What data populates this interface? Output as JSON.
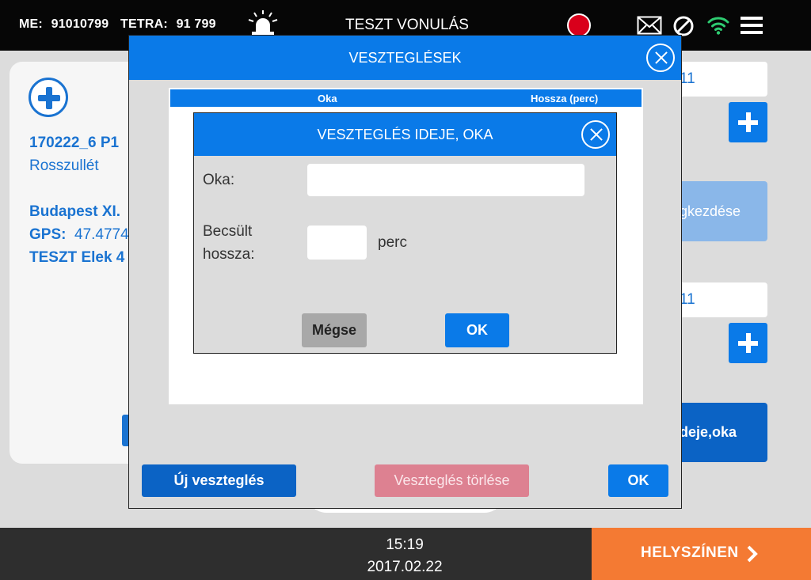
{
  "topbar": {
    "me_label": "ME:",
    "me_value": "91010799",
    "tetra_label": "TETRA:",
    "tetra_value": "91 799",
    "title": "TESZT VONULÁS",
    "icons": [
      "siren-icon",
      "record-indicator",
      "mail-icon",
      "block-icon",
      "wifi-icon",
      "menu-icon"
    ],
    "colors": {
      "record": "#d9001b",
      "wifi": "#2ecc71"
    }
  },
  "case": {
    "id_line": "170222_6  P1",
    "type": "Rosszullét",
    "address": "Budapest XI.",
    "gps_label": "GPS:",
    "gps_value": "47.4774",
    "person": "TESZT Elek  4"
  },
  "right_panel": {
    "field1": "11",
    "field2": "11",
    "faded_button": "gkezdése",
    "dark_button": "deje,oka"
  },
  "bottombar": {
    "time": "15:19",
    "date": "2017.02.22",
    "action": "HELYSZÍNEN"
  },
  "modal_outer": {
    "title": "VESZTEGLÉSEK",
    "columns": [
      "Oka",
      "Hossza (perc)"
    ],
    "new_button": "Új veszteglés",
    "delete_button": "Veszteglés törlése",
    "ok_button": "OK"
  },
  "modal_inner": {
    "title": "VESZTEGLÉS IDEJE, OKA",
    "reason_label": "Oka:",
    "reason_value": "",
    "duration_label_1": "Becsült",
    "duration_label_2": "hossza:",
    "duration_value": "",
    "unit": "perc",
    "cancel_button": "Mégse",
    "ok_button": "OK"
  }
}
